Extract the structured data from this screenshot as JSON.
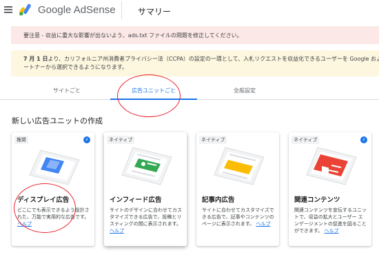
{
  "header": {
    "brand": "Google AdSense",
    "page_title": "サマリー"
  },
  "banners": {
    "error": "要注意 - 収益に重大な影響が出ないよう、ads.txt ファイルの問題を修正してください。",
    "info_bold": "7 月 1 日",
    "info_line1": "より、カリフォルニア州消費者プライバシー法（CCPA）の設定の一環として、入札リクエストを収益化できるユーザーを Google および Goo",
    "info_line2": "ートナーから選択できるようになります。"
  },
  "tabs": [
    {
      "label": "サイトごと"
    },
    {
      "label": "広告ユニットごと",
      "selected": true
    },
    {
      "label": "全般設定"
    }
  ],
  "section_title": "新しい広告ユニットの作成",
  "cards": [
    {
      "badge": "推奨",
      "title": "ディスプレイ広告",
      "desc": "どこにでも表示できるよう設計された、万能で実用的な広告です。",
      "help": "ヘルプ",
      "has_bolt": true,
      "color": "#4285f4"
    },
    {
      "badge": "ネイティブ",
      "title": "インフィード広告",
      "desc": "サイトのデザインに合わせてカスタマイズできる広告で、投稿とリスティングの間に表示されます。",
      "help": "ヘルプ",
      "has_bolt": false,
      "color": "#34a853"
    },
    {
      "badge": "ネイティブ",
      "title": "記事内広告",
      "desc": "サイトに合わせてカスタマイズできる広告で、記事やコンテンツのページに表示されます。",
      "help": "ヘルプ",
      "has_bolt": false,
      "color": "#fbbc04"
    },
    {
      "badge": "ネイティブ",
      "title": "関連コンテンツ",
      "desc": "関連コンテンツを宣伝するユニットで、収益の拡大とユーザー エンゲージメントの促進を図ることができます。",
      "help": "ヘルプ",
      "has_bolt": true,
      "color": "#ea4335"
    }
  ],
  "colors": {
    "accent": "#1a73e8",
    "annotation": "#e8202a"
  }
}
